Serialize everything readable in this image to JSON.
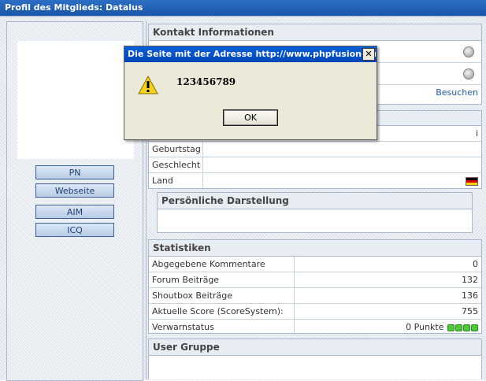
{
  "window": {
    "title": "Profil des Mitglieds: Datalus"
  },
  "sidebar": {
    "buttons": [
      {
        "label": "PN"
      },
      {
        "label": "Webseite"
      },
      {
        "label": "AIM"
      },
      {
        "label": "ICQ"
      }
    ]
  },
  "contact": {
    "title": "Kontakt Informationen",
    "visit_link": "Besuchen"
  },
  "profile": {
    "rows": [
      {
        "label": "Geburtstag",
        "value": ""
      },
      {
        "label": "Geschlecht",
        "value": ""
      },
      {
        "label": "Land",
        "value": ""
      }
    ],
    "flag_icon": "germany-flag-icon",
    "personal_title": "Persönliche Darstellung"
  },
  "stats": {
    "title": "Statistiken",
    "rows": [
      {
        "label": "Abgegebene Kommentare",
        "value": "0"
      },
      {
        "label": "Forum Beiträge",
        "value": "132"
      },
      {
        "label": "Shoutbox Beiträge",
        "value": "136"
      },
      {
        "label": "Aktuelle Score (ScoreSystem):",
        "value": "755"
      },
      {
        "label": "Verwarnstatus",
        "value": "0 Punkte"
      }
    ]
  },
  "usergroup": {
    "title": "User Gruppe"
  },
  "dialog": {
    "title": "Die Seite mit der Adresse http://www.phpfusion-su...",
    "message": "123456789",
    "ok_label": "OK",
    "close_label": "✕",
    "icon": "warning-icon"
  },
  "colors": {
    "titlebar": "#1a55a8",
    "link": "#1f57a6",
    "warn_green": "#4fc93a"
  }
}
